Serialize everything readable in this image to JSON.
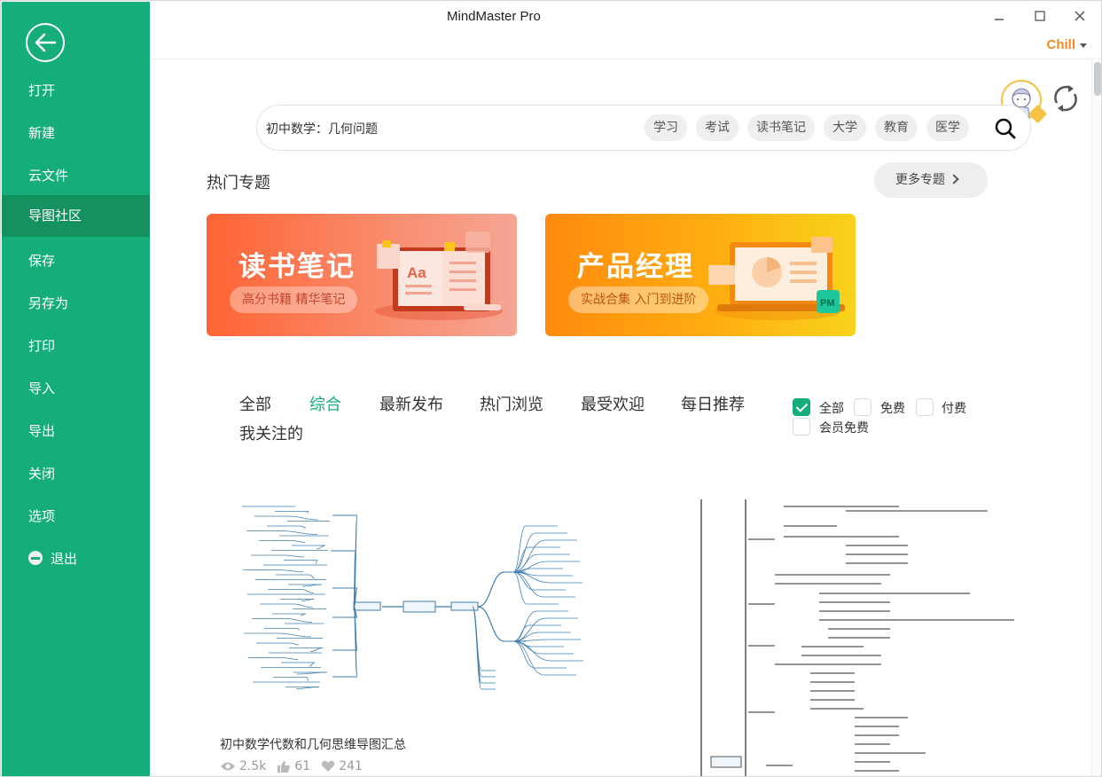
{
  "window": {
    "title": "MindMaster Pro",
    "user_name": "Chill",
    "controls": {
      "minimize": "minimize",
      "maximize": "maximize",
      "close": "close"
    }
  },
  "sidebar": {
    "back_icon": "arrow-left-circle-icon",
    "items": [
      {
        "label": "打开",
        "active": false
      },
      {
        "label": "新建",
        "active": false
      },
      {
        "label": "云文件",
        "active": false
      },
      {
        "label": "导图社区",
        "active": true
      },
      {
        "label": "保存",
        "active": false
      },
      {
        "label": "另存为",
        "active": false
      },
      {
        "label": "打印",
        "active": false
      },
      {
        "label": "导入",
        "active": false
      },
      {
        "label": "导出",
        "active": false
      },
      {
        "label": "关闭",
        "active": false
      },
      {
        "label": "选项",
        "active": false
      }
    ],
    "exit_label": "退出"
  },
  "search": {
    "query": "初中数学：几何问题",
    "tags": [
      "学习",
      "考试",
      "读书笔记",
      "大学",
      "教育",
      "医学"
    ]
  },
  "topics": {
    "title": "热门专题",
    "more_label": "更多专题",
    "banners": [
      {
        "title": "读书笔记",
        "subtitle": "高分书籍 精华笔记"
      },
      {
        "title": "产品经理",
        "subtitle": "实战合集 入门到进阶",
        "badge": "PM"
      }
    ]
  },
  "filters": {
    "tabs": [
      {
        "label": "全部",
        "active": false
      },
      {
        "label": "综合",
        "active": true
      },
      {
        "label": "最新发布",
        "active": false
      },
      {
        "label": "热门浏览",
        "active": false
      },
      {
        "label": "最受欢迎",
        "active": false
      },
      {
        "label": "每日推荐",
        "active": false
      },
      {
        "label": "我关注的",
        "active": false
      }
    ],
    "price": [
      {
        "label": "全部",
        "checked": true
      },
      {
        "label": "免费",
        "checked": false
      },
      {
        "label": "付费",
        "checked": false
      },
      {
        "label": "会员免费",
        "checked": false
      }
    ]
  },
  "cards": [
    {
      "title": "初中数学代数和几何思维导图汇总",
      "views": "2.5k",
      "likes": "61",
      "favorites": "241"
    },
    {
      "title": ""
    }
  ],
  "colors": {
    "brand_green": "#16ae78",
    "sidebar_active": "#13925f",
    "user_orange": "#f08a24",
    "avatar_ring": "#f5c242"
  }
}
